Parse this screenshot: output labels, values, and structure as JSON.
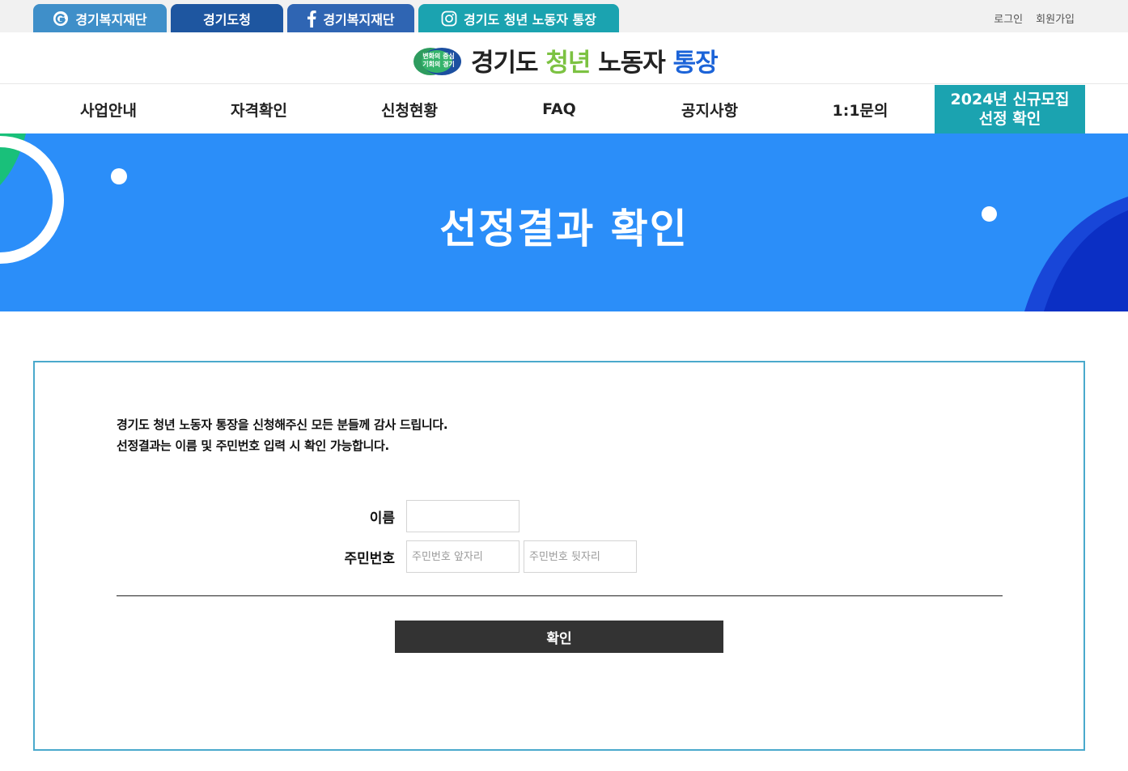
{
  "topbar": {
    "tabs": [
      {
        "label": "경기복지재단",
        "icon": "foundation-g-icon"
      },
      {
        "label": "경기도청",
        "icon": ""
      },
      {
        "label": "경기복지재단",
        "icon": "facebook-icon"
      },
      {
        "label": "경기도 청년 노동자 통장",
        "icon": "instagram-icon"
      }
    ],
    "login": "로그인",
    "signup": "회원가입"
  },
  "header": {
    "badge_line1": "변화의 중심",
    "badge_line2": "기회의 경기",
    "title_part1": "경기도 ",
    "title_part2": "청년",
    "title_part3": " 노동자 ",
    "title_part4": "통장"
  },
  "nav": {
    "items": [
      "사업안내",
      "자격확인",
      "신청현황",
      "FAQ",
      "공지사항",
      "1:1문의"
    ],
    "cta_line1": "2024년 신규모집",
    "cta_line2": "선정 확인"
  },
  "banner": {
    "title": "선정결과 확인",
    "background": "#2b8ef9"
  },
  "form": {
    "intro_line1": "경기도 청년 노동자 통장을 신청해주신 모든 분들께 감사 드립니다.",
    "intro_line2": "선정결과는 이름 및 주민번호 입력 시 확인 가능합니다.",
    "name_label": "이름",
    "name_value": "",
    "rrn_label": "주민번호",
    "rrn_front_placeholder": "주민번호 앞자리",
    "rrn_back_placeholder": "주민번호 뒷자리",
    "submit_label": "확인"
  },
  "colors": {
    "accent_teal": "#1ba3b0",
    "navy": "#1e56a0",
    "brand_green": "#7cc242",
    "brand_blue": "#1b63d8",
    "border": "#4aa9cc",
    "button": "#333333"
  }
}
